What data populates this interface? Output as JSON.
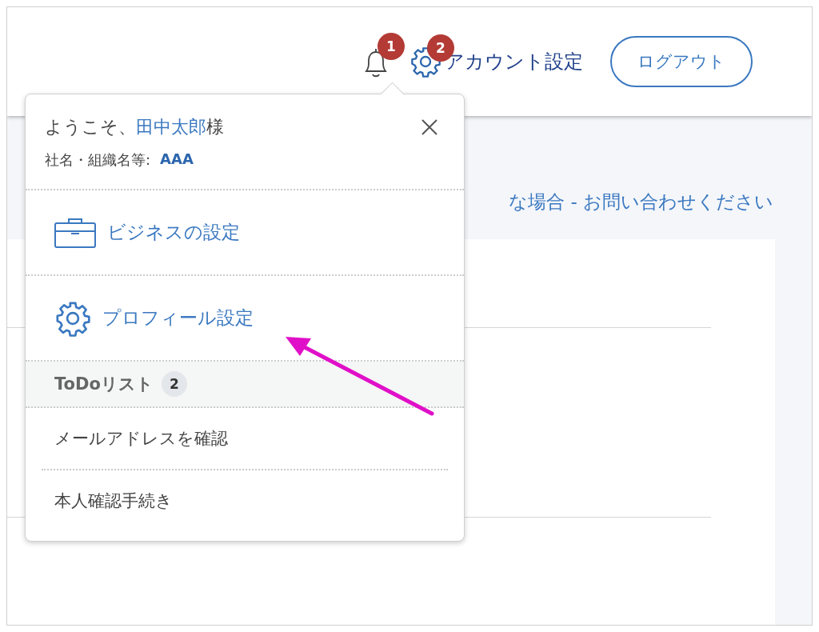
{
  "header": {
    "notifications": {
      "badge": "1"
    },
    "settings": {
      "badge": "2",
      "label": "アカウント設定"
    },
    "logout_button": "ログアウト"
  },
  "banner_text": "な場合 - お問い合わせください",
  "dropdown": {
    "greeting_prefix": "ようこそ、",
    "user_name": "田中太郎",
    "greeting_suffix": "様",
    "company_label": "社名・組織名等:",
    "company_name": "AAA",
    "menu": [
      {
        "kind": "briefcase",
        "label": "ビジネスの設定"
      },
      {
        "kind": "gear",
        "label": "プロフィール設定"
      }
    ],
    "todo": {
      "title": "ToDoリスト",
      "count": "2",
      "items": [
        "メールアドレスを確認",
        "本人確認手続き"
      ]
    }
  }
}
